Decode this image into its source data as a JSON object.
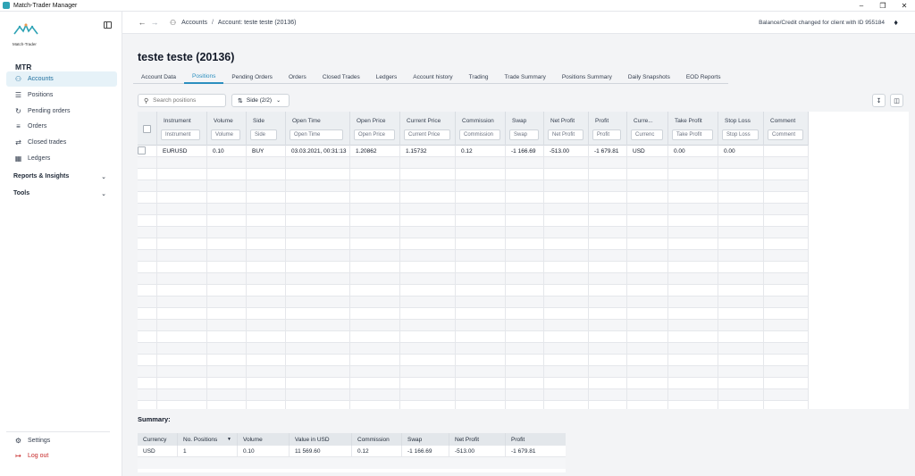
{
  "window": {
    "title": "Match-Trader Manager"
  },
  "brand": {
    "logo_text": "Match-Trader",
    "org": "MTR"
  },
  "sidebar": {
    "items": [
      {
        "label": "Accounts",
        "icon": "users-icon",
        "active": true
      },
      {
        "label": "Positions",
        "icon": "list-icon"
      },
      {
        "label": "Pending orders",
        "icon": "clock-list-icon"
      },
      {
        "label": "Orders",
        "icon": "orders-icon"
      },
      {
        "label": "Closed trades",
        "icon": "closed-trades-icon"
      },
      {
        "label": "Ledgers",
        "icon": "ledger-icon"
      }
    ],
    "sections": [
      {
        "label": "Reports & Insights"
      },
      {
        "label": "Tools"
      }
    ],
    "bottom": {
      "settings": "Settings",
      "logout": "Log out"
    }
  },
  "topbar": {
    "breadcrumb": {
      "root": "Accounts",
      "separator": "/",
      "current": "Account: teste teste (20136)"
    },
    "notice": "Balance/Credit changed for client with ID 955184"
  },
  "page": {
    "title": "teste teste (20136)"
  },
  "tabs": [
    "Account Data",
    "Positions",
    "Pending Orders",
    "Orders",
    "Closed Trades",
    "Ledgers",
    "Account history",
    "Trading",
    "Trade Summary",
    "Positions Summary",
    "Daily Snapshots",
    "EOD Reports"
  ],
  "toolbar": {
    "search_placeholder": "Search positions",
    "side_filter": "Side (2/2)"
  },
  "positions": {
    "columns": [
      {
        "label": "Instrument",
        "filter": "Instrument"
      },
      {
        "label": "Volume",
        "filter": "Volume"
      },
      {
        "label": "Side",
        "filter": "Side"
      },
      {
        "label": "Open Time",
        "filter": "Open Time"
      },
      {
        "label": "Open Price",
        "filter": "Open Price"
      },
      {
        "label": "Current Price",
        "filter": "Current Price"
      },
      {
        "label": "Commission",
        "filter": "Commission"
      },
      {
        "label": "Swap",
        "filter": "Swap"
      },
      {
        "label": "Net Profit",
        "filter": "Net Profit"
      },
      {
        "label": "Profit",
        "filter": "Profit"
      },
      {
        "label": "Curre...",
        "filter": "Currenc"
      },
      {
        "label": "Take Profit",
        "filter": "Take Profit"
      },
      {
        "label": "Stop Loss",
        "filter": "Stop Loss"
      },
      {
        "label": "Comment",
        "filter": "Comment"
      }
    ],
    "rows": [
      [
        "EURUSD",
        "0.10",
        "BUY",
        "03.03.2021, 00:31:13",
        "1.20862",
        "1.15732",
        "0.12",
        "-1 166.69",
        "-513.00",
        "-1 679.81",
        "USD",
        "0.00",
        "0.00",
        ""
      ]
    ]
  },
  "summary": {
    "title": "Summary:",
    "columns": [
      "Currency",
      "No. Positions",
      "Volume",
      "Value in USD",
      "Commission",
      "Swap",
      "Net Profit",
      "Profit"
    ],
    "rows": [
      [
        "USD",
        "1",
        "0.10",
        "11 569.60",
        "0.12",
        "-1 166.69",
        "-513.00",
        "-1 679.81"
      ]
    ]
  }
}
